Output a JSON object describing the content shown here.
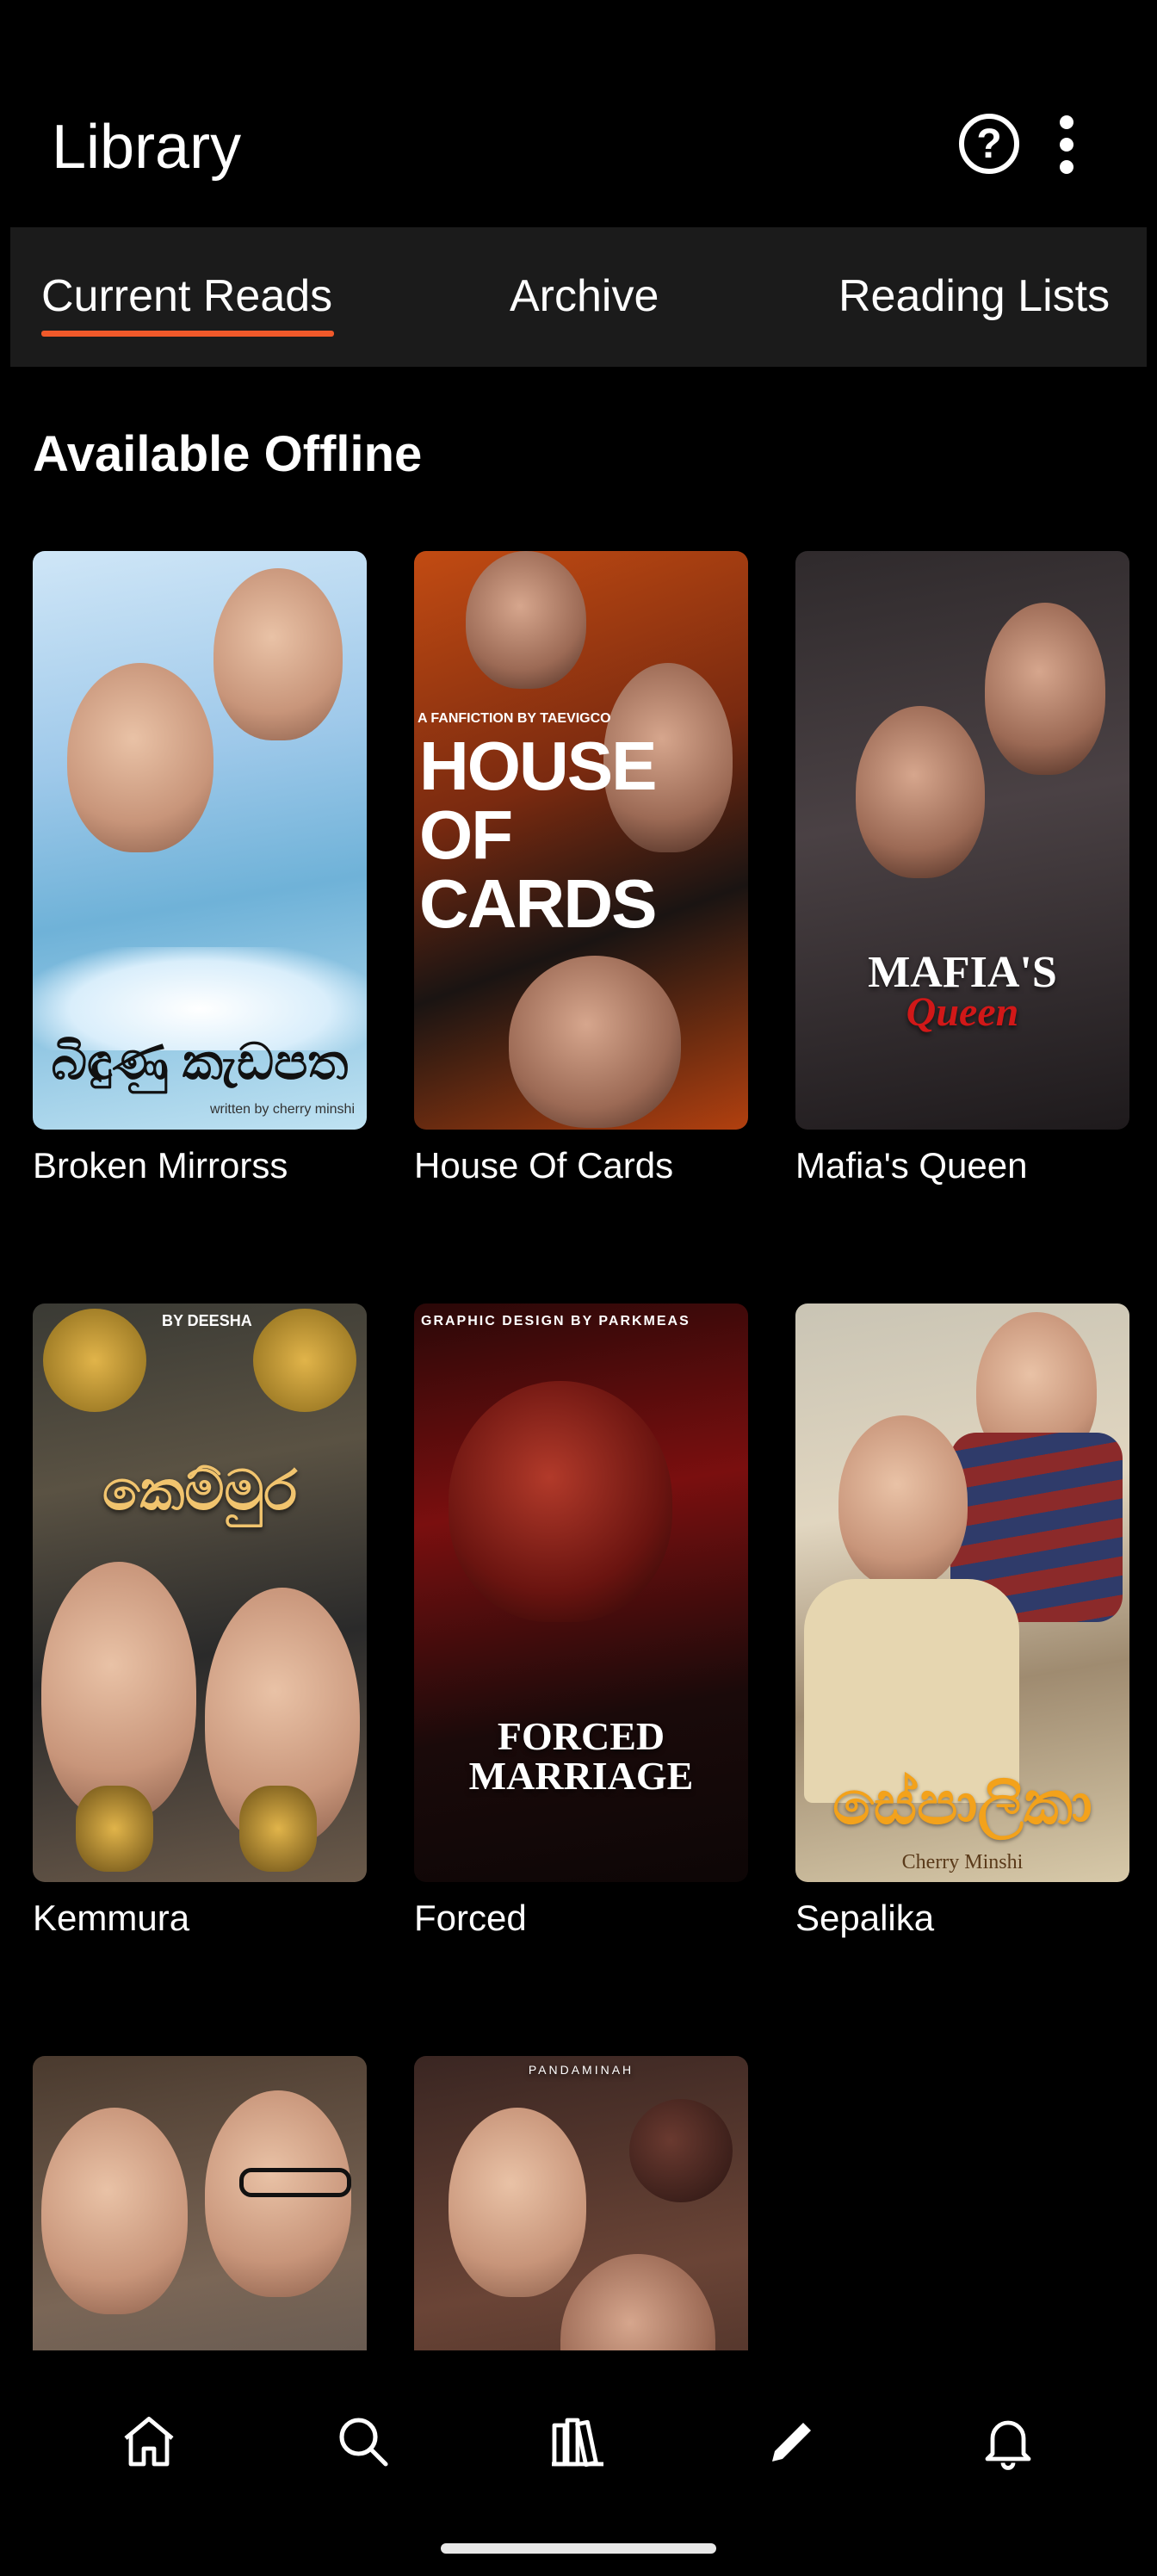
{
  "header": {
    "title": "Library",
    "help_icon": "help-circle-icon",
    "more_icon": "more-vertical-icon"
  },
  "tabs": [
    {
      "label": "Current Reads",
      "active": true
    },
    {
      "label": "Archive",
      "active": false
    },
    {
      "label": "Reading Lists",
      "active": false
    }
  ],
  "accent_color": "#f0592a",
  "section": {
    "title": "Available Offline"
  },
  "books": [
    {
      "title": "Broken Mirrorss",
      "cover_text": "බිඳුණු කැඩපත",
      "cover_subtext": "written by cherry minshi"
    },
    {
      "title": "House Of Cards",
      "cover_text": "HOUSE OF CARDS",
      "cover_subtext": "A FANFICTION BY TAEVIGCO"
    },
    {
      "title": "Mafia's Queen",
      "cover_text": "MAFIA'S",
      "cover_subtext": "Queen"
    },
    {
      "title": "Kemmura",
      "cover_text": "කෙම්මුර",
      "cover_subtext": "BY DEESHA"
    },
    {
      "title": "Forced",
      "cover_text": "FORCED MARRIAGE",
      "cover_subtext": "GRAPHIC DESIGN BY PARKMEAS"
    },
    {
      "title": "Sepalika",
      "cover_text": "සේපාලිකා",
      "cover_subtext": "Cherry Minshi"
    },
    {
      "title": "",
      "cover_text": "",
      "cover_subtext": ""
    },
    {
      "title": "",
      "cover_text": "",
      "cover_subtext": "PANDAMINAH"
    }
  ],
  "bottom_nav": [
    {
      "name": "home-icon"
    },
    {
      "name": "search-icon"
    },
    {
      "name": "library-icon"
    },
    {
      "name": "write-icon"
    },
    {
      "name": "notifications-icon"
    }
  ]
}
